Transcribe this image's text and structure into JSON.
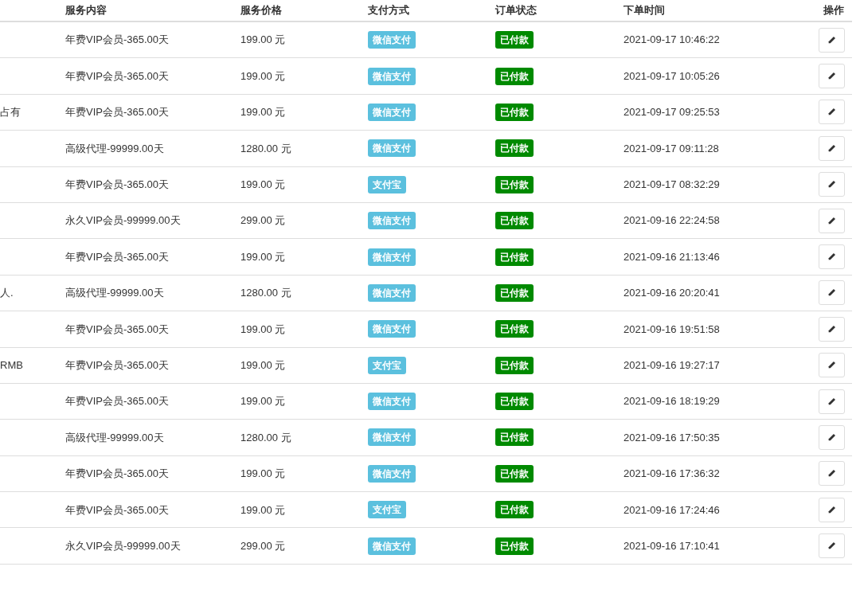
{
  "table": {
    "columns": [
      "服务内容",
      "服务价格",
      "支付方式",
      "订单状态",
      "下单时间",
      "操作"
    ],
    "rows": [
      {
        "service": "年费VIP会员-365.00天",
        "price": "199.00 元",
        "payment": "微信支付",
        "status": "已付款",
        "time": "2021-09-17 10:46:22"
      },
      {
        "service": "年费VIP会员-365.00天",
        "price": "199.00 元",
        "payment": "微信支付",
        "status": "已付款",
        "time": "2021-09-17 10:05:26"
      },
      {
        "column_1": "占有",
        "service": "年费VIP会员-365.00天",
        "price": "199.00 元",
        "payment": "微信支付",
        "status": "已付款",
        "time": "2021-09-17 09:25:53"
      },
      {
        "service": "高级代理-99999.00天",
        "price": "1280.00 元",
        "payment": "微信支付",
        "status": "已付款",
        "time": "2021-09-17 09:11:28"
      },
      {
        "service": "年费VIP会员-365.00天",
        "price": "199.00 元",
        "payment": "支付宝",
        "status": "已付款",
        "time": "2021-09-17 08:32:29"
      },
      {
        "service": "永久VIP会员-99999.00天",
        "price": "299.00 元",
        "payment": "微信支付",
        "status": "已付款",
        "time": "2021-09-16 22:24:58"
      },
      {
        "service": "年费VIP会员-365.00天",
        "price": "199.00 元",
        "payment": "微信支付",
        "status": "已付款",
        "time": "2021-09-16 21:13:46"
      },
      {
        "column_1": "人.",
        "service": "高级代理-99999.00天",
        "price": "1280.00 元",
        "payment": "微信支付",
        "status": "已付款",
        "time": "2021-09-16 20:20:41"
      },
      {
        "service": "年费VIP会员-365.00天",
        "price": "199.00 元",
        "payment": "微信支付",
        "status": "已付款",
        "time": "2021-09-16 19:51:58"
      },
      {
        "column_1": "RMB",
        "service": "年费VIP会员-365.00天",
        "price": "199.00 元",
        "payment": "支付宝",
        "status": "已付款",
        "time": "2021-09-16 19:27:17"
      },
      {
        "service": "年费VIP会员-365.00天",
        "price": "199.00 元",
        "payment": "微信支付",
        "status": "已付款",
        "time": "2021-09-16 18:19:29"
      },
      {
        "service": "高级代理-99999.00天",
        "price": "1280.00 元",
        "payment": "微信支付",
        "status": "已付款",
        "time": "2021-09-16 17:50:35"
      },
      {
        "service": "年费VIP会员-365.00天",
        "price": "199.00 元",
        "payment": "微信支付",
        "status": "已付款",
        "time": "2021-09-16 17:36:32"
      },
      {
        "service": "年费VIP会员-365.00天",
        "price": "199.00 元",
        "payment": "支付宝",
        "status": "已付款",
        "time": "2021-09-16 17:24:46"
      },
      {
        "service": "永久VIP会员-99999.00天",
        "price": "299.00 元",
        "payment": "微信支付",
        "status": "已付款",
        "time": "2021-09-16 17:10:41"
      }
    ]
  }
}
